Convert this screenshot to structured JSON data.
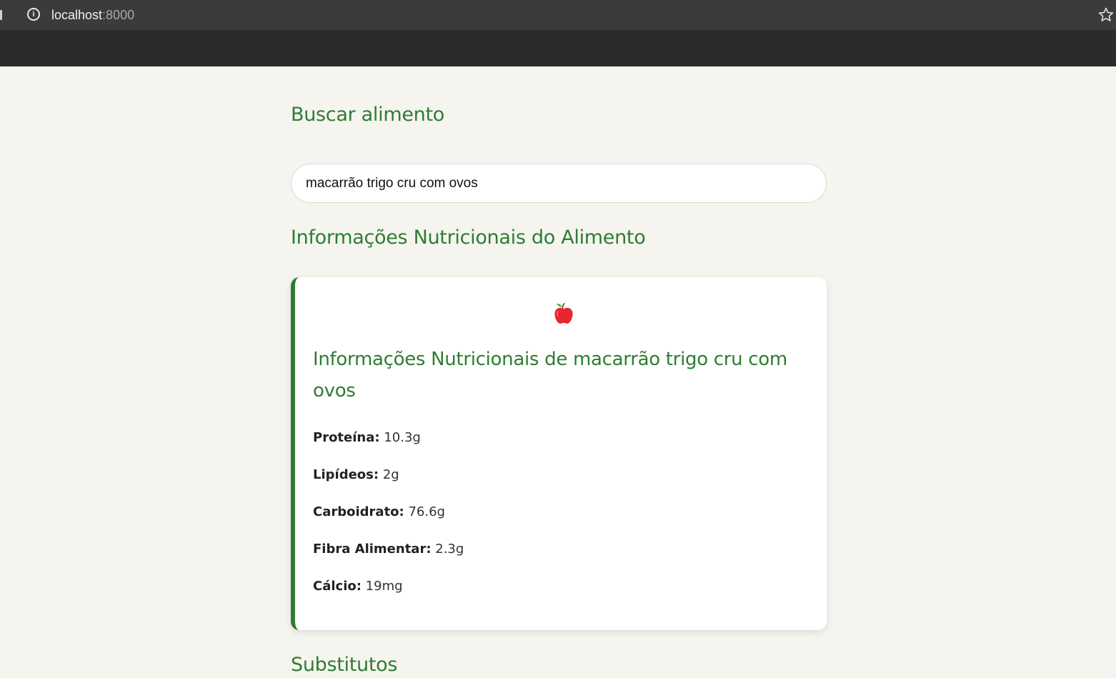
{
  "browser": {
    "url_host": "localhost",
    "url_port": ":8000"
  },
  "search": {
    "title": "Buscar alimento",
    "value": "macarrão trigo cru com ovos"
  },
  "info": {
    "section_title": "Informações Nutricionais do Alimento",
    "card_title": "Informações Nutricionais de macarrão trigo cru com ovos",
    "icon": "apple-icon",
    "nutrients": [
      {
        "label": "Proteína:",
        "value": "10.3g"
      },
      {
        "label": "Lipídeos:",
        "value": "2g"
      },
      {
        "label": "Carboidrato:",
        "value": "76.6g"
      },
      {
        "label": "Fibra Alimentar:",
        "value": "2.3g"
      },
      {
        "label": "Cálcio:",
        "value": "19mg"
      }
    ]
  },
  "substitutes": {
    "section_title": "Substitutos"
  },
  "colors": {
    "accent": "#2e7d32",
    "page_bg": "#f5f4ef",
    "browser_bg": "#3b3b3b"
  }
}
